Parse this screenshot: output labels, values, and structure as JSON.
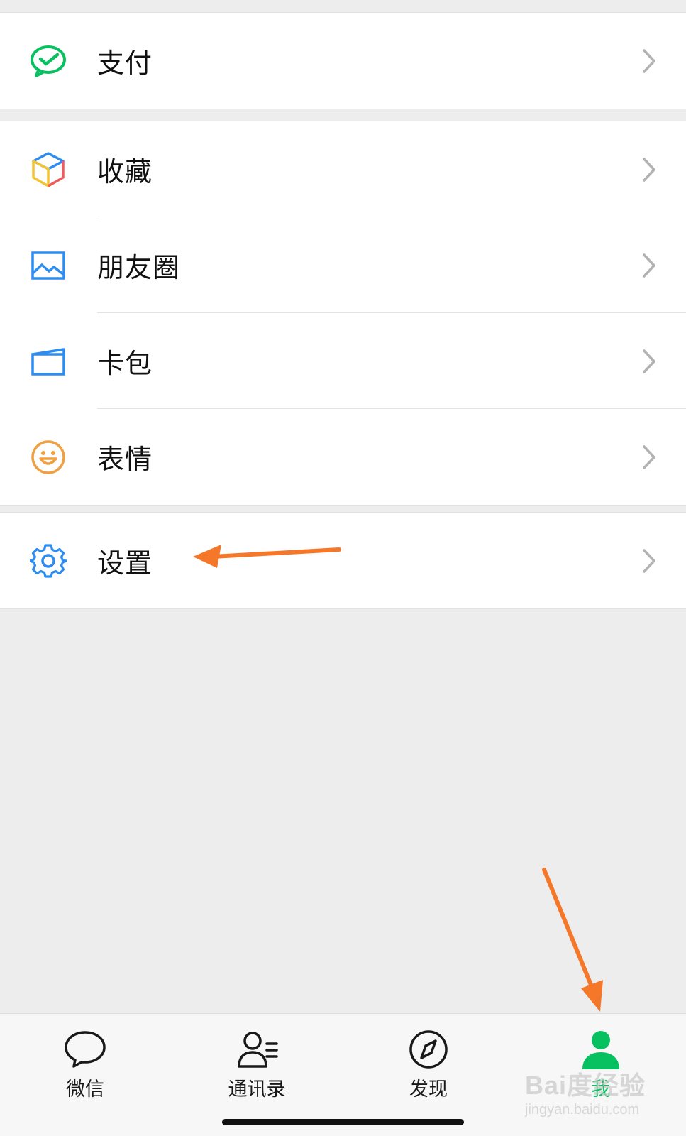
{
  "menu_groups": [
    {
      "items": [
        {
          "label": "支付",
          "icon": "wechat-pay-icon"
        }
      ]
    },
    {
      "items": [
        {
          "label": "收藏",
          "icon": "favorites-cube-icon"
        },
        {
          "label": "朋友圈",
          "icon": "moments-image-icon"
        },
        {
          "label": "卡包",
          "icon": "card-wallet-icon"
        },
        {
          "label": "表情",
          "icon": "emoji-smile-icon"
        }
      ]
    },
    {
      "items": [
        {
          "label": "设置",
          "icon": "gear-icon"
        }
      ]
    }
  ],
  "tabbar": {
    "tabs": [
      {
        "label": "微信",
        "icon": "chat-bubble-icon",
        "active": false
      },
      {
        "label": "通讯录",
        "icon": "contacts-icon",
        "active": false
      },
      {
        "label": "发现",
        "icon": "compass-icon",
        "active": false
      },
      {
        "label": "我",
        "icon": "me-person-icon",
        "active": true
      }
    ]
  },
  "watermark": {
    "logo": "Bai度经验",
    "url": "jingyan.baidu.com"
  },
  "colors": {
    "accent_green": "#07c160",
    "annotation_orange": "#f5782a",
    "background": "#ededed"
  }
}
